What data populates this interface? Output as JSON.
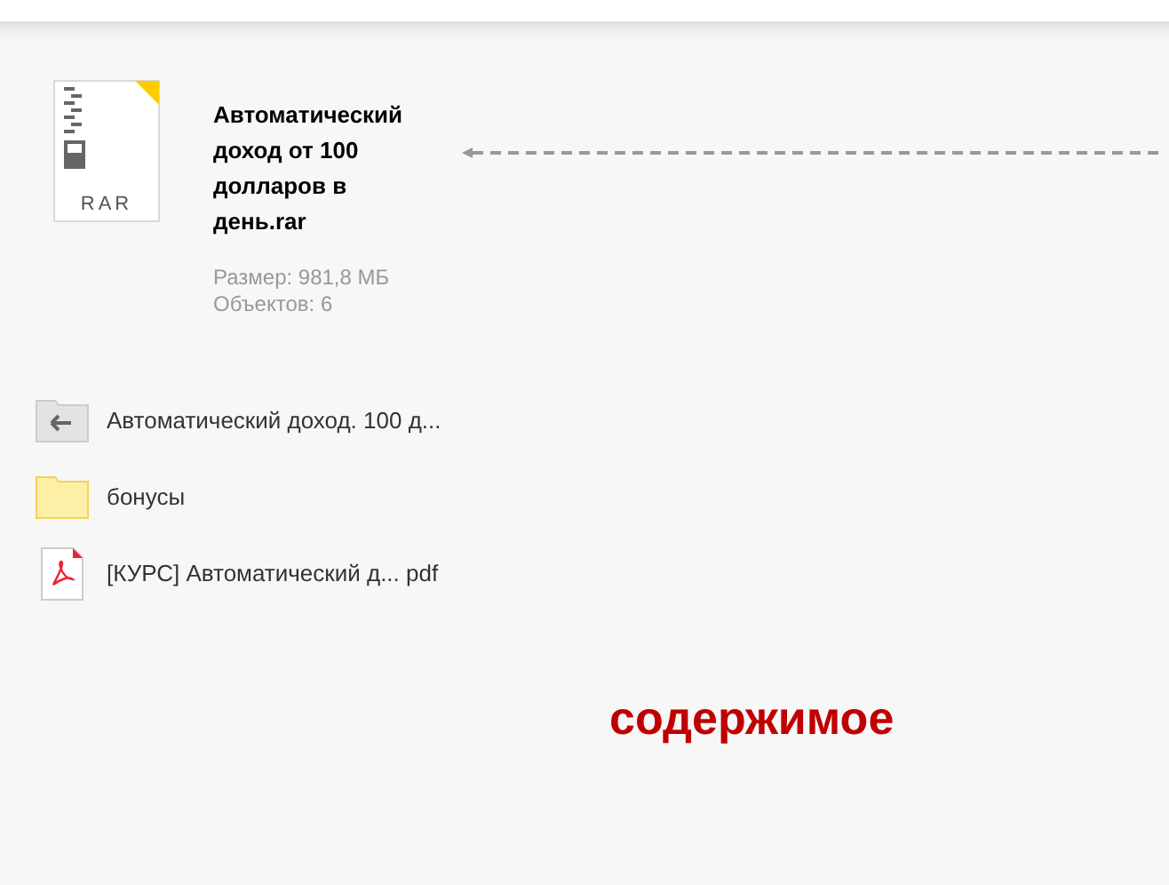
{
  "archive": {
    "name": "Автоматический доход от 100 долларов в день.rar",
    "icon_label": "RAR",
    "size": "Размер: 981,8 МБ",
    "objects": "Объектов: 6"
  },
  "items": [
    {
      "kind": "back",
      "name": "Автоматический доход. 100 д..."
    },
    {
      "kind": "folder",
      "name": "бонусы"
    },
    {
      "kind": "pdf",
      "name": "[КУРС] Автоматический д... pdf"
    }
  ],
  "annotation": "содержимое"
}
